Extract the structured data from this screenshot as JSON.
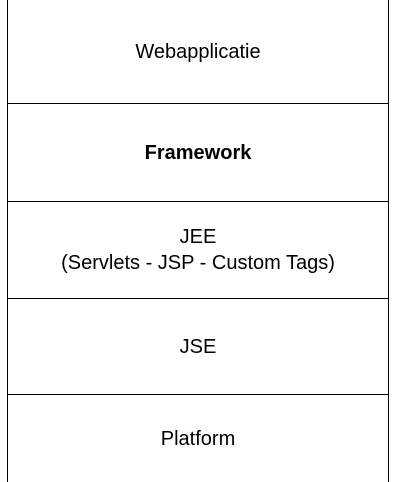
{
  "diagram": {
    "layers": [
      {
        "id": "webapplicatie",
        "lines": [
          "Webapplicatie"
        ],
        "bold": false
      },
      {
        "id": "framework",
        "lines": [
          "Framework"
        ],
        "bold": true
      },
      {
        "id": "jee",
        "lines": [
          "JEE",
          "(Servlets - JSP - Custom Tags)"
        ],
        "bold": false
      },
      {
        "id": "jse",
        "lines": [
          "JSE"
        ],
        "bold": false
      },
      {
        "id": "platform",
        "lines": [
          "Platform"
        ],
        "bold": false
      }
    ]
  }
}
